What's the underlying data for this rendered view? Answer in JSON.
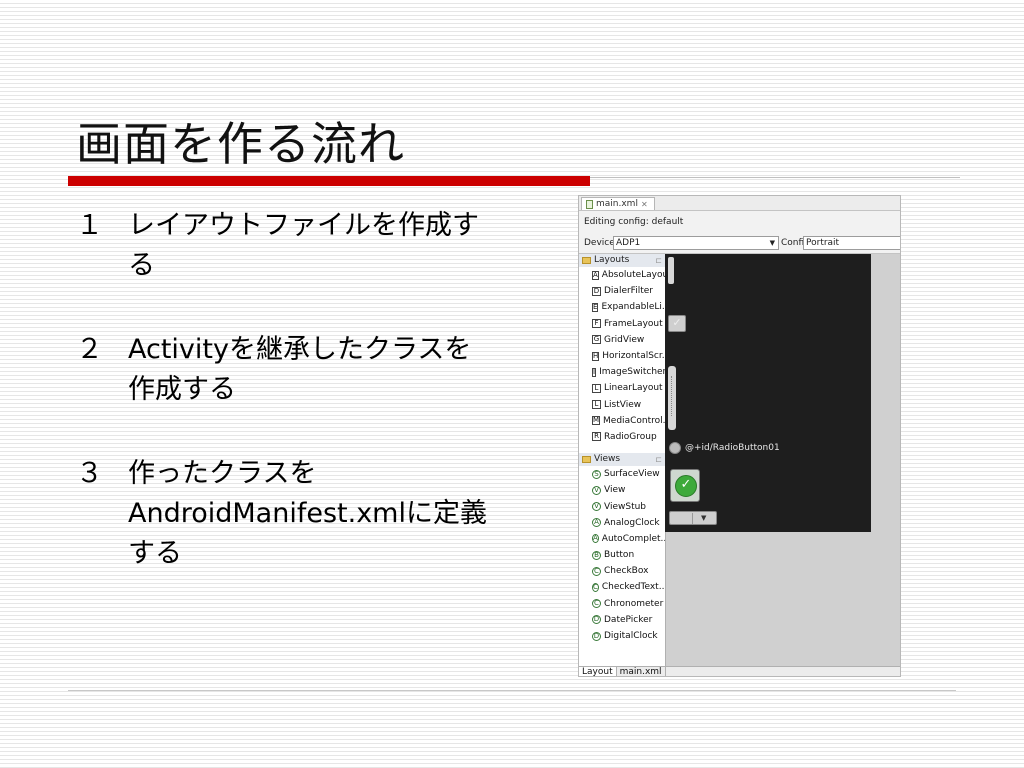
{
  "slide": {
    "title": "画面を作る流れ",
    "steps": [
      {
        "num": "１",
        "text": "レイアウトファイルを作成する"
      },
      {
        "num": "２",
        "text": "Activityを継承したクラスを作成する"
      },
      {
        "num": "３",
        "text": "作ったクラスをAndroidManifest.xmlに定義する"
      }
    ]
  },
  "editor": {
    "tab_label": "main.xml",
    "tab_close": "✕",
    "config_text": "Editing config: default",
    "devices_label": "Devices",
    "device_value": "ADP1",
    "config_label": "Config",
    "config_value": "Portrait",
    "palette": {
      "layouts_header": "Layouts",
      "layouts": [
        {
          "badge": "A",
          "label": "AbsoluteLayout"
        },
        {
          "badge": "D",
          "label": "DialerFilter"
        },
        {
          "badge": "E",
          "label": "ExpandableLi..."
        },
        {
          "badge": "F",
          "label": "FrameLayout"
        },
        {
          "badge": "G",
          "label": "GridView"
        },
        {
          "badge": "H",
          "label": "HorizontalScr..."
        },
        {
          "badge": "I",
          "label": "ImageSwitcher"
        },
        {
          "badge": "L",
          "label": "LinearLayout"
        },
        {
          "badge": "L",
          "label": "ListView"
        },
        {
          "badge": "M",
          "label": "MediaControl..."
        },
        {
          "badge": "R",
          "label": "RadioGroup"
        }
      ],
      "views_header": "Views",
      "views": [
        {
          "badge": "S",
          "label": "SurfaceView"
        },
        {
          "badge": "V",
          "label": "View"
        },
        {
          "badge": "V",
          "label": "ViewStub"
        },
        {
          "badge": "A",
          "label": "AnalogClock"
        },
        {
          "badge": "A",
          "label": "AutoComplet..."
        },
        {
          "badge": "B",
          "label": "Button"
        },
        {
          "badge": "C",
          "label": "CheckBox"
        },
        {
          "badge": "C",
          "label": "CheckedText..."
        },
        {
          "badge": "C",
          "label": "Chronometer"
        },
        {
          "badge": "D",
          "label": "DatePicker"
        },
        {
          "badge": "D",
          "label": "DigitalClock"
        }
      ]
    },
    "canvas": {
      "radio_label": "@+id/RadioButton01"
    },
    "bottom_tabs": [
      "Layout",
      "main.xml"
    ]
  }
}
